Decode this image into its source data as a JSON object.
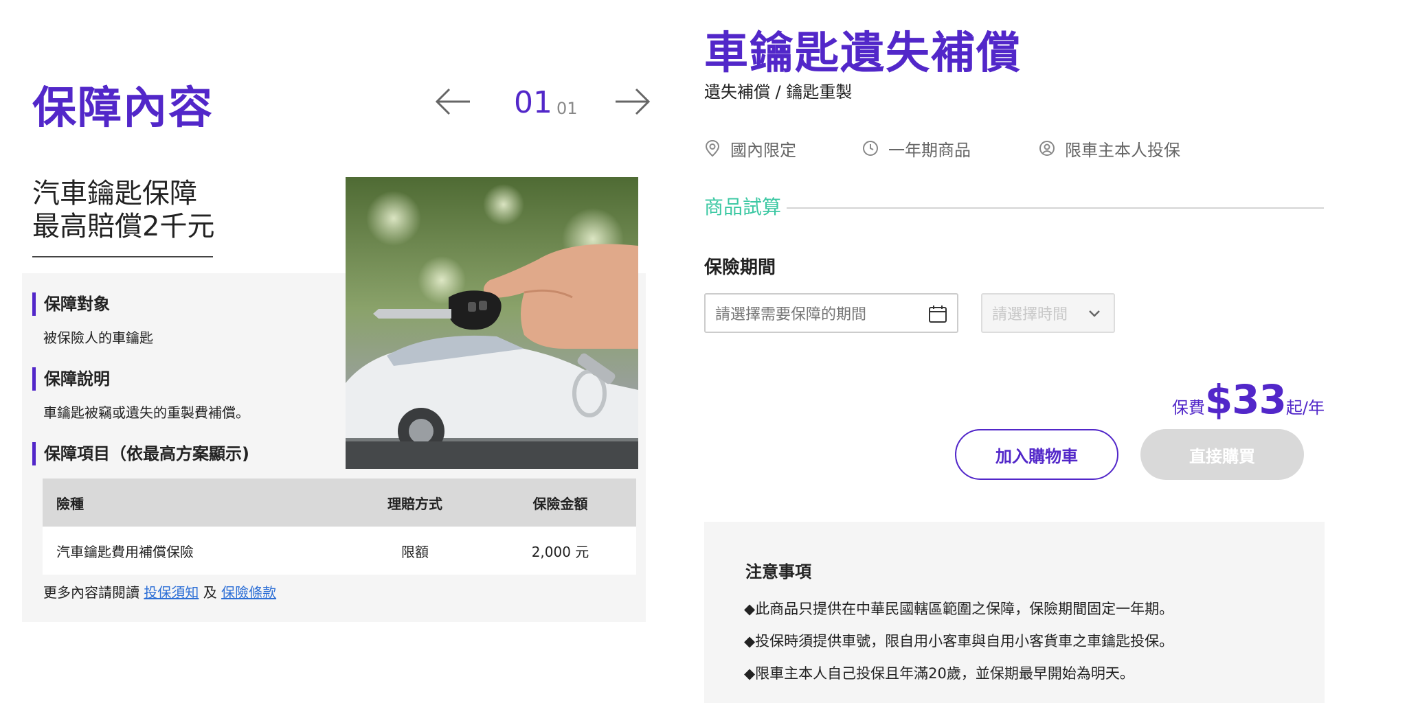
{
  "left": {
    "title": "保障內容",
    "pager": {
      "current": "01",
      "total": "01"
    },
    "headline_line1": "汽車鑰匙保障",
    "headline_line2": "最高賠償2千元",
    "sections": [
      {
        "label": "保障對象",
        "text": "被保險人的車鑰匙"
      },
      {
        "label": "保障說明",
        "text": "車鑰匙被竊或遺失的重製費補償。"
      },
      {
        "label": "保障項目（依最高方案顯示)"
      }
    ],
    "table": {
      "headers": [
        "險種",
        "理賠方式",
        "保險金額"
      ],
      "rows": [
        [
          "汽車鑰匙費用補償保險",
          "限額",
          "2,000 元"
        ]
      ]
    },
    "more_info": {
      "prefix": "更多內容請閱讀",
      "link1": "投保須知",
      "joiner": "及",
      "link2": "保險條款"
    }
  },
  "right": {
    "title": "車鑰匙遺失補償",
    "subtitle": "遺失補償 / 鑰匙重製",
    "features": [
      {
        "icon": "location-pin-icon",
        "label": "國內限定"
      },
      {
        "icon": "clock-icon",
        "label": "一年期商品"
      },
      {
        "icon": "user-icon",
        "label": "限車主本人投保"
      }
    ],
    "calc_label": "商品試算",
    "period_label": "保險期間",
    "date_placeholder": "請選擇需要保障的期間",
    "time_placeholder": "請選擇時間",
    "price": {
      "prefix": "保費",
      "value": "$33",
      "suffix": "起/年"
    },
    "cart_button": "加入購物車",
    "buy_button": "直接購買",
    "notice": {
      "title": "注意事項",
      "items": [
        "◆此商品只提供在中華民國轄區範圍之保障，保險期間固定一年期。",
        "◆投保時須提供車號，限自用小客車與自用小客貨車之車鑰匙投保。",
        "◆限車主本人自己投保且年滿20歲，並保期最早開始為明天。"
      ]
    }
  },
  "colors": {
    "brand_purple": "#5227c9",
    "accent_green": "#3cc8a3",
    "link_blue": "#2d6fd6",
    "disabled_gray": "#d9d9d9"
  }
}
